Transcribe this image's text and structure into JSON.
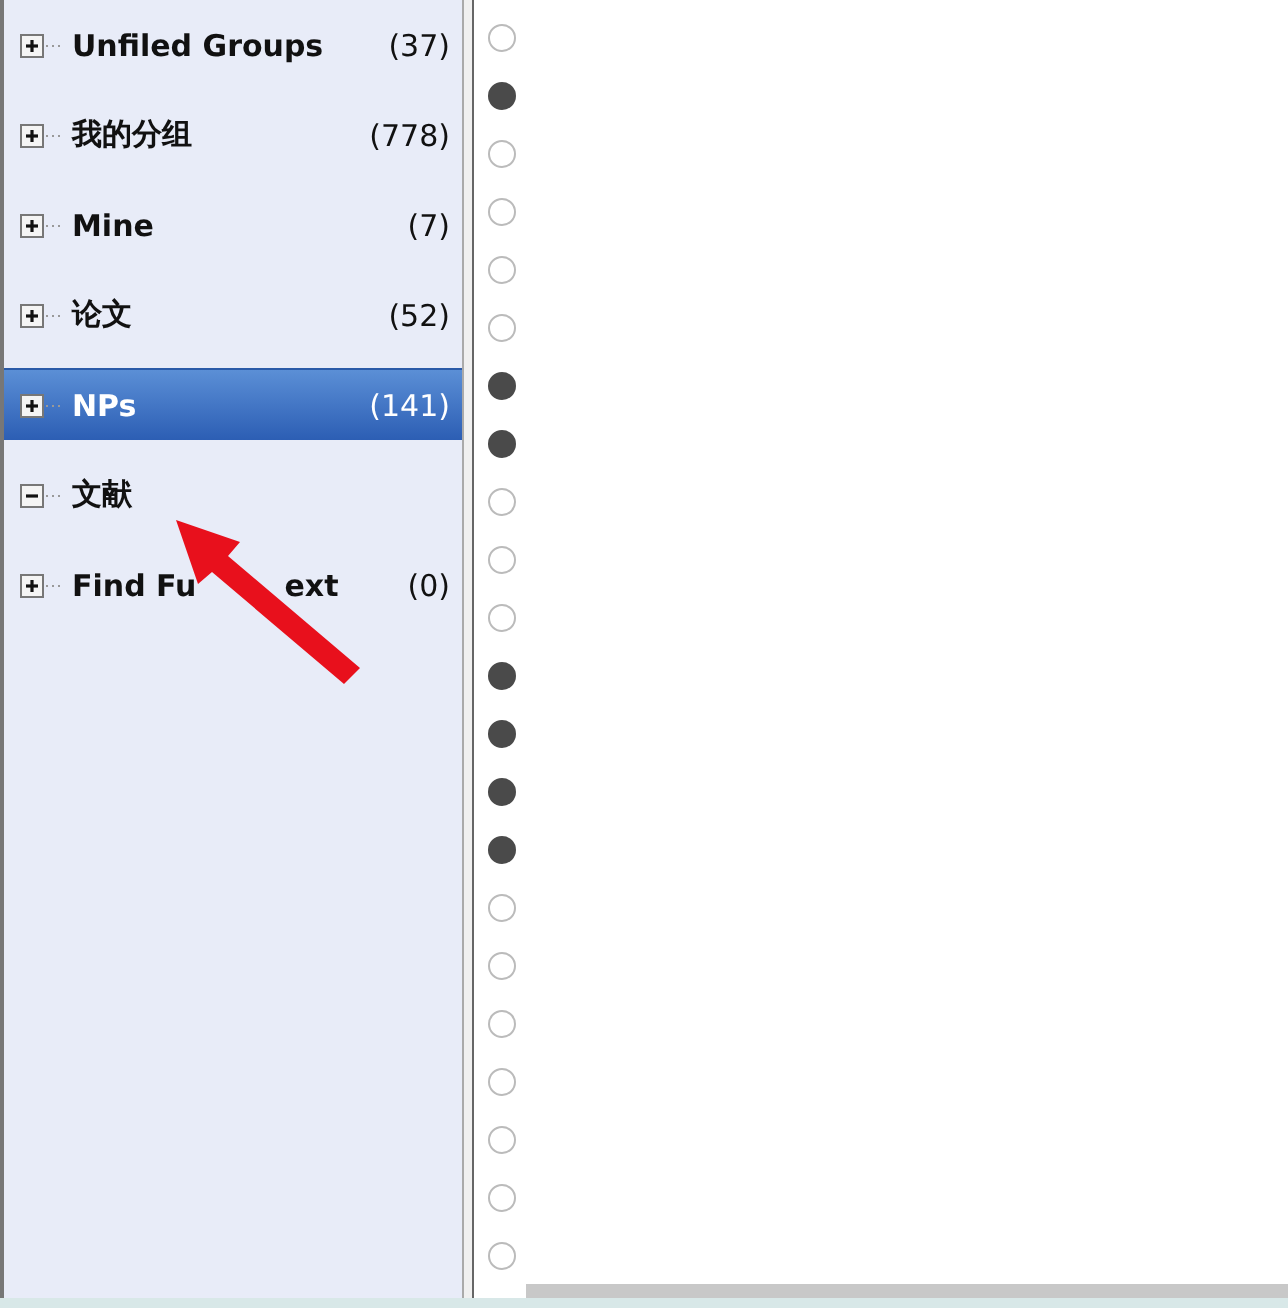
{
  "groups": [
    {
      "label": "Unfiled Groups",
      "count": "(37)",
      "expanded": false,
      "selected": false
    },
    {
      "label": "我的分组",
      "count": "(778)",
      "expanded": false,
      "selected": false
    },
    {
      "label": "Mine",
      "count": "(7)",
      "expanded": false,
      "selected": false
    },
    {
      "label": "论文",
      "count": "(52)",
      "expanded": false,
      "selected": false
    },
    {
      "label": "NPs",
      "count": "(141)",
      "expanded": false,
      "selected": true
    },
    {
      "label": "文献",
      "expanded": true,
      "selected": false
    },
    {
      "label": "Find Fu",
      "label_tail": "ext",
      "count": "(0)",
      "expanded": false,
      "selected": false
    }
  ],
  "references": [
    {
      "read": false
    },
    {
      "read": true
    },
    {
      "read": false
    },
    {
      "read": false
    },
    {
      "read": false
    },
    {
      "read": false
    },
    {
      "read": true
    },
    {
      "read": true
    },
    {
      "read": false
    },
    {
      "read": false
    },
    {
      "read": false
    },
    {
      "read": true
    },
    {
      "read": true
    },
    {
      "read": true
    },
    {
      "read": true
    },
    {
      "read": false
    },
    {
      "read": false
    },
    {
      "read": false
    },
    {
      "read": false
    },
    {
      "read": false
    },
    {
      "read": false
    },
    {
      "read": false
    }
  ]
}
